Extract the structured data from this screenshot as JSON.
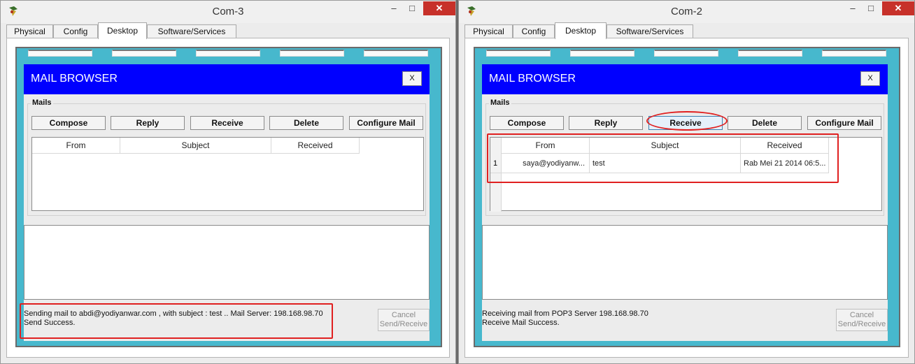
{
  "windows": [
    {
      "title": "Com-3",
      "window_buttons": {
        "minimize": "–",
        "maximize": "□",
        "close": "✕"
      },
      "tabs": [
        "Physical",
        "Config",
        "Desktop",
        "Software/Services"
      ],
      "active_tab": "Desktop",
      "app": {
        "title": "MAIL BROWSER",
        "close_label": "X",
        "mails_label": "Mails",
        "buttons": [
          "Compose",
          "Reply",
          "Receive",
          "Delete",
          "Configure Mail"
        ],
        "columns": [
          "From",
          "Subject",
          "Received"
        ],
        "rows": [],
        "status_lines": [
          "Sending mail to abdi@yodiyanwar.com , with subject : test ..   Mail Server: 198.168.98.70",
          "Send Success."
        ],
        "cancel_label": [
          "Cancel",
          "Send/Receive"
        ]
      }
    },
    {
      "title": "Com-2",
      "window_buttons": {
        "minimize": "–",
        "maximize": "□",
        "close": "✕"
      },
      "tabs": [
        "Physical",
        "Config",
        "Desktop",
        "Software/Services"
      ],
      "active_tab": "Desktop",
      "app": {
        "title": "MAIL BROWSER",
        "close_label": "X",
        "mails_label": "Mails",
        "buttons": [
          "Compose",
          "Reply",
          "Receive",
          "Delete",
          "Configure Mail"
        ],
        "columns": [
          "From",
          "Subject",
          "Received"
        ],
        "rows": [
          {
            "num": "1",
            "from": "saya@yodiyanw...",
            "subject": "test",
            "received": "Rab Mei 21 2014 06:5..."
          }
        ],
        "status_lines": [
          "Receiving mail from POP3 Server 198.168.98.70",
          "Receive Mail Success."
        ],
        "cancel_label": [
          "Cancel",
          "Send/Receive"
        ]
      }
    }
  ],
  "colors": {
    "mail_header": "#0000ff",
    "desktop_bg": "#47b8cd",
    "highlight": "#e02020"
  }
}
